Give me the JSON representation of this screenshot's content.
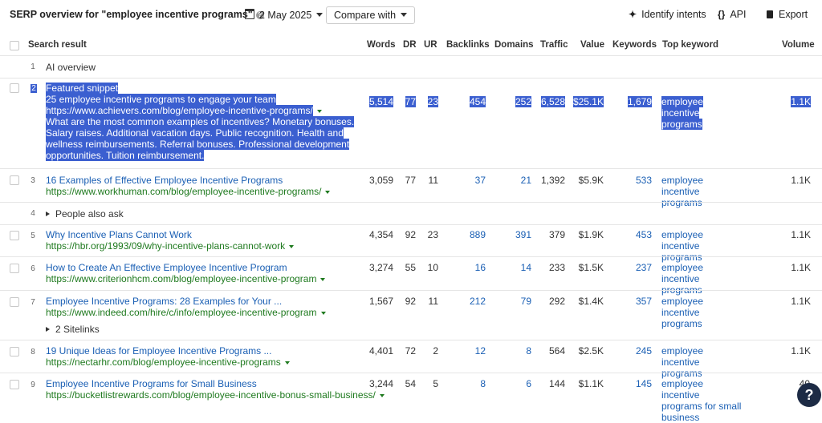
{
  "toolbar": {
    "title": "SERP overview for \"employee incentive programs\"",
    "date": "2 May 2025",
    "compare_label": "Compare with",
    "identify_intents": "Identify intents",
    "api": "API",
    "export": "Export"
  },
  "columns": {
    "search_result": "Search result",
    "words": "Words",
    "dr": "DR",
    "ur": "UR",
    "backlinks": "Backlinks",
    "domains": "Domains",
    "traffic": "Traffic",
    "value": "Value",
    "keywords": "Keywords",
    "top_keyword": "Top keyword",
    "volume": "Volume"
  },
  "rows": {
    "r1": {
      "num": "1",
      "label": "AI overview"
    },
    "r2": {
      "num": "2",
      "type": "Featured snippet",
      "title": "25 employee incentive programs to engage your team",
      "url": "https://www.achievers.com/blog/employee-incentive-programs/",
      "snippet": "What are the most common examples of incentives? Monetary bonuses. Salary raises. Additional vacation days. Public recognition. Health and wellness reimbursements. Referral bonuses. Professional development opportunities. Tuition reimbursement.",
      "words": "5,514",
      "dr": "77",
      "ur": "23",
      "backlinks": "454",
      "domains": "252",
      "traffic": "6,528",
      "value": "$25.1K",
      "keywords": "1,679",
      "top_keyword": "employee incentive programs",
      "volume": "1.1K"
    },
    "r3": {
      "num": "3",
      "title": "16 Examples of Effective Employee Incentive Programs",
      "url": "https://www.workhuman.com/blog/employee-incentive-programs/",
      "words": "3,059",
      "dr": "77",
      "ur": "11",
      "backlinks": "37",
      "domains": "21",
      "traffic": "1,392",
      "value": "$5.9K",
      "keywords": "533",
      "top_keyword": "employee incentive programs",
      "volume": "1.1K"
    },
    "r4": {
      "num": "4",
      "label": "People also ask"
    },
    "r5": {
      "num": "5",
      "title": "Why Incentive Plans Cannot Work",
      "url": "https://hbr.org/1993/09/why-incentive-plans-cannot-work",
      "words": "4,354",
      "dr": "92",
      "ur": "23",
      "backlinks": "889",
      "domains": "391",
      "traffic": "379",
      "value": "$1.9K",
      "keywords": "453",
      "top_keyword": "employee incentive programs",
      "volume": "1.1K"
    },
    "r6": {
      "num": "6",
      "title": "How to Create An Effective Employee Incentive Program",
      "url": "https://www.criterionhcm.com/blog/employee-incentive-program",
      "words": "3,274",
      "dr": "55",
      "ur": "10",
      "backlinks": "16",
      "domains": "14",
      "traffic": "233",
      "value": "$1.5K",
      "keywords": "237",
      "top_keyword": "employee incentive programs",
      "volume": "1.1K"
    },
    "r7": {
      "num": "7",
      "title": "Employee Incentive Programs: 28 Examples for Your ...",
      "url": "https://www.indeed.com/hire/c/info/employee-incentive-program",
      "sitelinks": "2 Sitelinks",
      "words": "1,567",
      "dr": "92",
      "ur": "11",
      "backlinks": "212",
      "domains": "79",
      "traffic": "292",
      "value": "$1.4K",
      "keywords": "357",
      "top_keyword": "employee incentive programs",
      "volume": "1.1K"
    },
    "r8": {
      "num": "8",
      "title": "19 Unique Ideas for Employee Incentive Programs ...",
      "url": "https://nectarhr.com/blog/employee-incentive-programs",
      "words": "4,401",
      "dr": "72",
      "ur": "2",
      "backlinks": "12",
      "domains": "8",
      "traffic": "564",
      "value": "$2.5K",
      "keywords": "245",
      "top_keyword": "employee incentive programs",
      "volume": "1.1K"
    },
    "r9": {
      "num": "9",
      "title": "Employee Incentive Programs for Small Business",
      "url": "https://bucketlistrewards.com/blog/employee-incentive-bonus-small-business/",
      "words": "3,244",
      "dr": "54",
      "ur": "5",
      "backlinks": "8",
      "domains": "6",
      "traffic": "144",
      "value": "$1.1K",
      "keywords": "145",
      "top_keyword": "employee incentive programs for small business",
      "volume": "40"
    }
  },
  "help_fab": "?"
}
